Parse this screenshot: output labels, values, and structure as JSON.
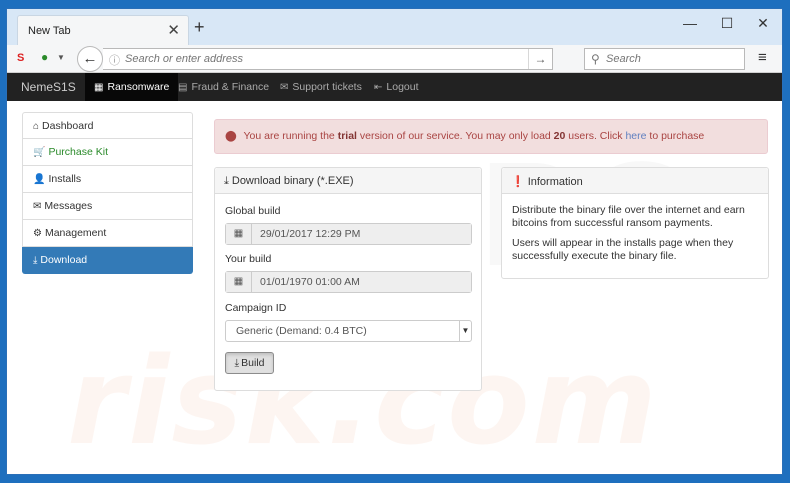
{
  "browser": {
    "tab_title": "New Tab",
    "tab_close": "✕",
    "new_tab": "+",
    "window_controls": {
      "minimize": "—",
      "maximize": "☐",
      "close": "✕"
    },
    "url_placeholder": "Search or enter address",
    "search_placeholder": "Search",
    "icons": {
      "extension_1": "S",
      "extension_2": "●",
      "back": "←",
      "go": "→",
      "search": "⚲",
      "menu": "≡",
      "info": "ⓘ"
    }
  },
  "app": {
    "brand": "NemeS1S",
    "nav": [
      {
        "label": "Ransomware",
        "icon": "▦",
        "active": true
      },
      {
        "label": "Fraud & Finance",
        "icon": "▤",
        "active": false
      },
      {
        "label": "Support tickets",
        "icon": "✉",
        "active": false
      },
      {
        "label": "Logout",
        "icon": "⇤",
        "active": false
      }
    ]
  },
  "sidebar": {
    "items": [
      {
        "label": "Dashboard",
        "icon": "⌂"
      },
      {
        "label": "Purchase Kit",
        "icon": "🛒"
      },
      {
        "label": "Installs",
        "icon": "👤"
      },
      {
        "label": "Messages",
        "icon": "✉"
      },
      {
        "label": "Management",
        "icon": "⚙"
      },
      {
        "label": "Download",
        "icon": "⤓"
      }
    ]
  },
  "alert": {
    "icon": "!",
    "prefix": "You are running the",
    "trial": "trial",
    "middle": "version of our service. You may only load",
    "count": "20",
    "suffix": "users. Click",
    "link": "here",
    "tail": "to purchase"
  },
  "download_panel": {
    "title": "Download binary (*.EXE)",
    "title_icon": "⤓",
    "global_build_label": "Global build",
    "global_build_value": "29/01/2017 12:29 PM",
    "your_build_label": "Your build",
    "your_build_value": "01/01/1970 01:00 AM",
    "calendar_icon": "▦",
    "campaign_label": "Campaign ID",
    "campaign_value": "Generic (Demand: 0.4 BTC)",
    "build_button": "Build",
    "build_icon": "⤓"
  },
  "info_panel": {
    "title": "Information",
    "title_icon": "❗",
    "text_1": "Distribute the binary file over the internet and earn bitcoins from successful ransom payments.",
    "text_2": "Users will appear in the installs page when they successfully execute the binary file."
  },
  "colors": {
    "nav_bg": "#222222",
    "active_blue": "#337ab7",
    "alert_bg": "#f2dede",
    "alert_text": "#a94442"
  }
}
